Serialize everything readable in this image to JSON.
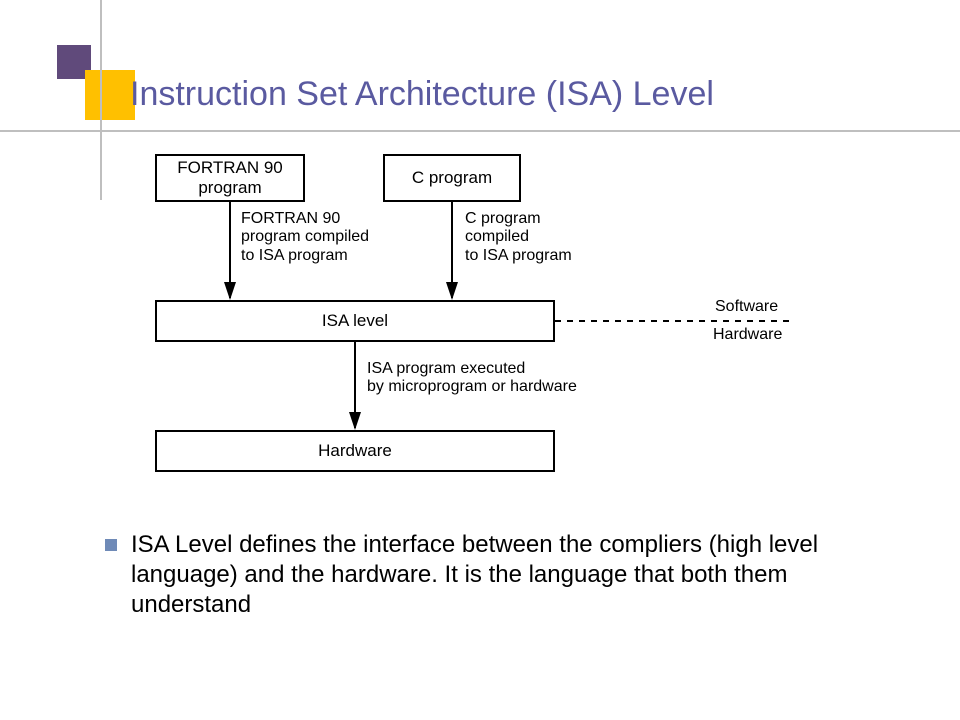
{
  "title": "Instruction Set Architecture (ISA) Level",
  "diagram": {
    "box_fortran": "FORTRAN 90\nprogram",
    "box_c": "C program",
    "box_isa": "ISA level",
    "box_hw": "Hardware",
    "label_fortran": "FORTRAN 90\nprogram compiled\nto ISA program",
    "label_c": "C program\ncompiled\nto ISA program",
    "label_exec": "ISA program executed\nby microprogram or hardware",
    "label_sw": "Software",
    "label_hw": "Hardware"
  },
  "bullet": "ISA Level defines the interface between the compliers (high level language) and the hardware. It is the language that both them understand"
}
